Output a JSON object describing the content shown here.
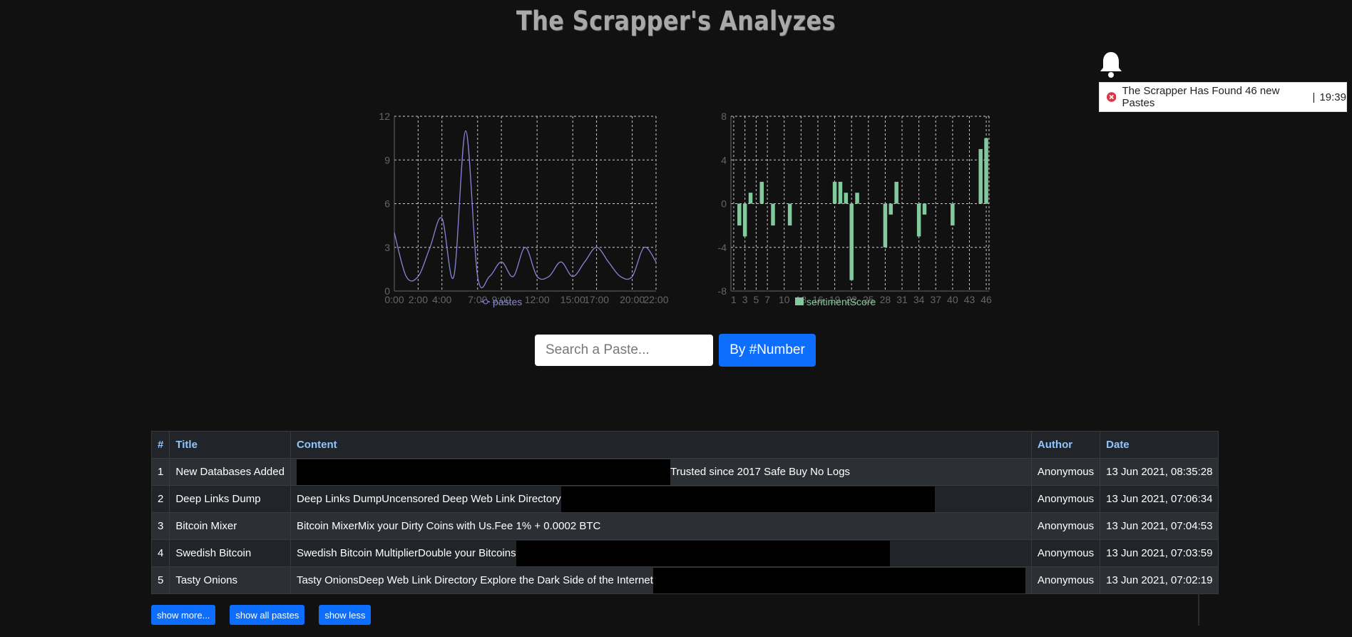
{
  "header": {
    "title": "The  Scrapper's  Analyzes"
  },
  "notification": {
    "message": "The Scrapper Has Found 46 new Pastes",
    "separator": "|",
    "time": "19:39"
  },
  "search": {
    "placeholder": "Search a Paste...",
    "button_label": "By #Number"
  },
  "table": {
    "headers": [
      "#",
      "Title",
      "Content",
      "Author",
      "Date"
    ],
    "rows": [
      {
        "num": "1",
        "title": "New Databases Added",
        "content_pre": "",
        "content_post": "Trusted since 2017 Safe Buy No Logs",
        "author": "Anonymous",
        "date": "13 Jun 2021, 08:35:28"
      },
      {
        "num": "2",
        "title": "Deep Links Dump",
        "content_pre": "Deep Links DumpUncensored Deep Web Link Directory",
        "content_post": "",
        "author": "Anonymous",
        "date": "13 Jun 2021, 07:06:34"
      },
      {
        "num": "3",
        "title": "Bitcoin Mixer",
        "content_pre": "Bitcoin MixerMix your Dirty Coins with Us.Fee 1% + 0.0002 BTC",
        "content_post": "",
        "author": "Anonymous",
        "date": "13 Jun 2021, 07:04:53"
      },
      {
        "num": "4",
        "title": "Swedish Bitcoin",
        "content_pre": "Swedish Bitcoin MultiplierDouble your Bitcoins",
        "content_post": "",
        "author": "Anonymous",
        "date": "13 Jun 2021, 07:03:59"
      },
      {
        "num": "5",
        "title": "Tasty Onions",
        "content_pre": "Tasty OnionsDeep Web Link Directory Explore the Dark Side of the Internet",
        "content_post": "",
        "author": "Anonymous",
        "date": "13 Jun 2021, 07:02:19"
      }
    ]
  },
  "buttons": {
    "show_more": "show more...",
    "show_all": "show all pastes",
    "show_less": "show less"
  },
  "colors": {
    "line": "#8884d8",
    "bar": "#82ca9d",
    "accent": "#0d6efd"
  },
  "icons": {
    "bell": "bell-icon",
    "error": "error-circle-icon"
  },
  "chart_data": [
    {
      "type": "line",
      "legend": "pastes",
      "x": [
        "0:00",
        "1:00",
        "2:00",
        "3:00",
        "4:00",
        "5:00",
        "6:00",
        "7:00",
        "8:00",
        "9:00",
        "10:00",
        "11:00",
        "12:00",
        "13:00",
        "14:00",
        "15:00",
        "16:00",
        "17:00",
        "18:00",
        "19:00",
        "20:00",
        "21:00",
        "22:00"
      ],
      "x_tick_labels": [
        "0:00",
        "2:00",
        "4:00",
        "7:00",
        "9:00",
        "12:00",
        "15:00",
        "17:00",
        "20:00",
        "22:00"
      ],
      "values": [
        4,
        1,
        1,
        3,
        5,
        1,
        11,
        1,
        1,
        2,
        1,
        3,
        1,
        1,
        2,
        1,
        2,
        3,
        2,
        1,
        1,
        3,
        2
      ],
      "ylim": [
        0,
        12
      ],
      "yticks": [
        0,
        3,
        6,
        9,
        12
      ],
      "grid": true,
      "legend_position": "bottom"
    },
    {
      "type": "bar",
      "legend": "sentimentScore",
      "categories": [
        "1",
        "2",
        "3",
        "4",
        "5",
        "6",
        "7",
        "8",
        "9",
        "10",
        "11",
        "12",
        "13",
        "14",
        "15",
        "16",
        "17",
        "18",
        "19",
        "20",
        "21",
        "22",
        "23",
        "24",
        "25",
        "26",
        "27",
        "28",
        "29",
        "30",
        "31",
        "32",
        "33",
        "34",
        "35",
        "36",
        "37",
        "38",
        "39",
        "40",
        "41",
        "42",
        "43",
        "44",
        "45",
        "46"
      ],
      "x_tick_labels": [
        "1",
        "3",
        "5",
        "7",
        "10",
        "13",
        "16",
        "19",
        "22",
        "25",
        "28",
        "31",
        "34",
        "37",
        "40",
        "43",
        "46"
      ],
      "values": [
        0,
        -2,
        -3,
        1,
        0,
        2,
        0,
        -2,
        0,
        0,
        -2,
        0,
        0,
        0,
        0,
        0,
        0,
        0,
        2,
        2,
        1,
        -7,
        1,
        0,
        0,
        0,
        0,
        -4,
        -1,
        2,
        0,
        0,
        0,
        -3,
        -1,
        0,
        0,
        0,
        0,
        -2,
        0,
        0,
        0,
        0,
        5,
        6
      ],
      "ylim": [
        -8,
        8
      ],
      "yticks": [
        -8,
        -4,
        0,
        4,
        8
      ],
      "grid": true,
      "legend_position": "bottom"
    }
  ]
}
